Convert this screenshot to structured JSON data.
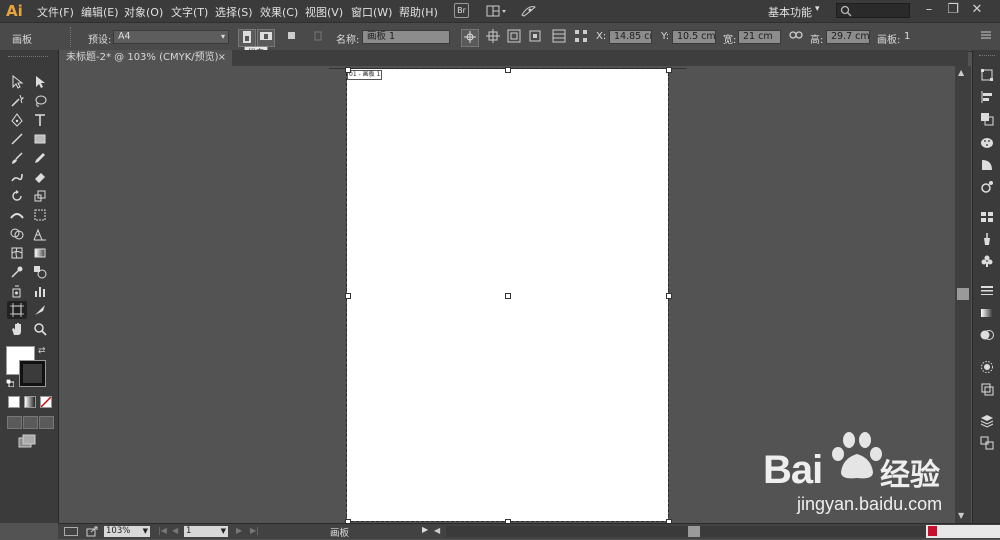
{
  "app": {
    "logo": "Ai"
  },
  "menus": [
    "文件(F)",
    "编辑(E)",
    "对象(O)",
    "文字(T)",
    "选择(S)",
    "效果(C)",
    "视图(V)",
    "窗口(W)",
    "帮助(H)"
  ],
  "bridge_label": "Br",
  "workspace": {
    "label": "基本功能",
    "arrow": "▾"
  },
  "window_controls": {
    "minimize": "–",
    "restore": "❐",
    "close": "✕"
  },
  "control_bar": {
    "context_label": "画板",
    "preset_label": "预设:",
    "preset_value": "A4",
    "orientation_tooltip": "纵向",
    "name_label": "名称:",
    "name_value": "画板 1",
    "x_label": "X:",
    "x_value": "14.85 cm",
    "y_label": "Y:",
    "y_value": "10.5 cm",
    "width_label": "宽:",
    "width_value": "21 cm",
    "height_label": "高:",
    "height_value": "29.7 cm",
    "artboards_label": "画板:",
    "artboards_value": "1"
  },
  "document_tab": {
    "title": "未标题-2* @ 103% (CMYK/预览)",
    "close": "×"
  },
  "artboard": {
    "label": "01 - 画板 1"
  },
  "status_bar": {
    "zoom": "103%",
    "page": "1",
    "tool_status": "画板"
  },
  "watermark": {
    "brand_left": "Bai",
    "brand_right": "经验",
    "url": "jingyan.baidu.com"
  },
  "colors": {
    "accent": "#e8a33c",
    "canvas": "#535353",
    "chrome": "#3b3b3b",
    "baidu_red": "#e10602",
    "baidu_blue": "#2319dc"
  }
}
